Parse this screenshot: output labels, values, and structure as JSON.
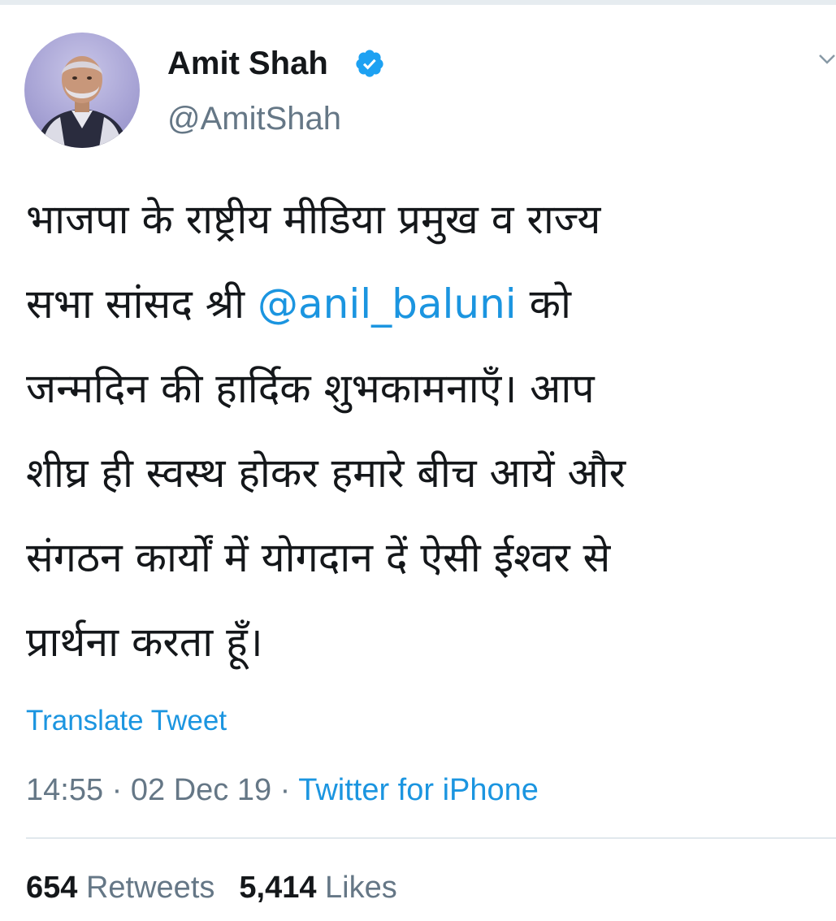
{
  "user": {
    "display_name": "Amit Shah",
    "handle": "@AmitShah",
    "verified": true
  },
  "tweet": {
    "lines": [
      {
        "pre": "भाजपा के राष्ट्रीय मीडिया प्रमुख व राज्य"
      },
      {
        "pre": "सभा सांसद श्री ",
        "mention": "@anil_baluni",
        "post": " को"
      },
      {
        "pre": "जन्मदिन की हार्दिक शुभकामनाएँ। आप"
      },
      {
        "pre": "शीघ्र ही स्वस्थ होकर हमारे बीच आयें और"
      },
      {
        "pre": "संगठन कार्यों में योगदान दें ऐसी ईश्वर से"
      },
      {
        "pre": "प्रार्थना करता हूँ।"
      }
    ],
    "translate_label": "Translate Tweet",
    "time": "14:55",
    "date": "02 Dec 19",
    "separator": " · ",
    "source": "Twitter for iPhone"
  },
  "stats": {
    "retweets_count": "654",
    "retweets_label": "Retweets",
    "likes_count": "5,414",
    "likes_label": "Likes"
  },
  "icons": {
    "verified": "verified-badge-icon",
    "caret": "chevron-down-icon"
  },
  "colors": {
    "link": "#1b95e0",
    "secondary_text": "#657786",
    "primary_text": "#14171a"
  }
}
